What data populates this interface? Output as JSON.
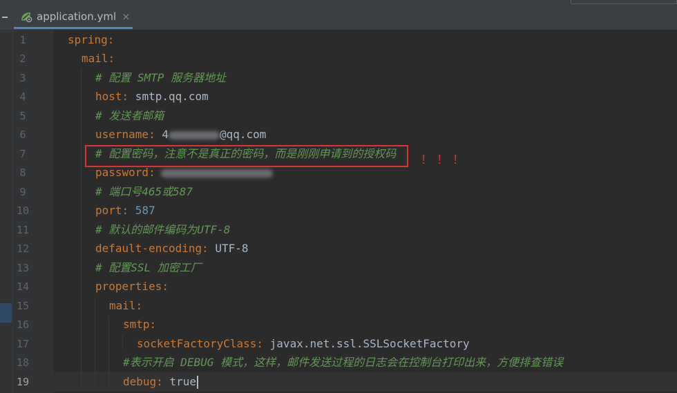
{
  "tab": {
    "title": "application.yml",
    "close": "×",
    "icon": "spring-leaf-gear-icon"
  },
  "gutter": {
    "line_numbers": [
      "1",
      "2",
      "3",
      "4",
      "5",
      "6",
      "7",
      "8",
      "9",
      "10",
      "11",
      "12",
      "13",
      "14",
      "15",
      "16",
      "17",
      "18",
      "19"
    ],
    "current_line": "19"
  },
  "code": {
    "l1_key": "spring",
    "l1_sep": ":",
    "l2_key": "mail",
    "l2_sep": ":",
    "l3_comment": "# 配置 SMTP 服务器地址",
    "l4_key": "host",
    "l4_sep": ":",
    "l4_val": " smtp.qq.com",
    "l5_comment": "# 发送者邮箱",
    "l6_key": "username",
    "l6_sep": ":",
    "l6_val_prefix": " 4",
    "l6_val_suffix": "@qq.com",
    "l7_comment": "# 配置密码，注意不是真正的密码，而是刚刚申请到的授权码",
    "l8_key": "password",
    "l8_sep": ":",
    "l9_comment": "# 端口号465或587",
    "l10_key": "port",
    "l10_sep": ":",
    "l10_val": " 587",
    "l11_comment": "# 默认的邮件编码为UTF-8",
    "l12_key": "default-encoding",
    "l12_sep": ":",
    "l12_val": " UTF-8",
    "l13_comment": "# 配置SSL 加密工厂",
    "l14_key": "properties",
    "l14_sep": ":",
    "l15_key": "mail",
    "l15_sep": ":",
    "l16_key": "smtp",
    "l16_sep": ":",
    "l17_key": "socketFactoryClass",
    "l17_sep": ":",
    "l17_val": " javax.net.ssl.SSLSocketFactory",
    "l18_comment": "#表示开启 DEBUG 模式，这样，邮件发送过程的日志会在控制台打印出来，方便排查错误",
    "l19_key": "debug",
    "l19_sep": ":",
    "l19_val": " true"
  },
  "annotation": {
    "exclaim": "！！！",
    "box_color": "#e03030"
  },
  "colors": {
    "background": "#2b2b2b",
    "key": "#cc7832",
    "comment": "#629755",
    "number": "#6897bb",
    "text": "#a9b7c6"
  }
}
